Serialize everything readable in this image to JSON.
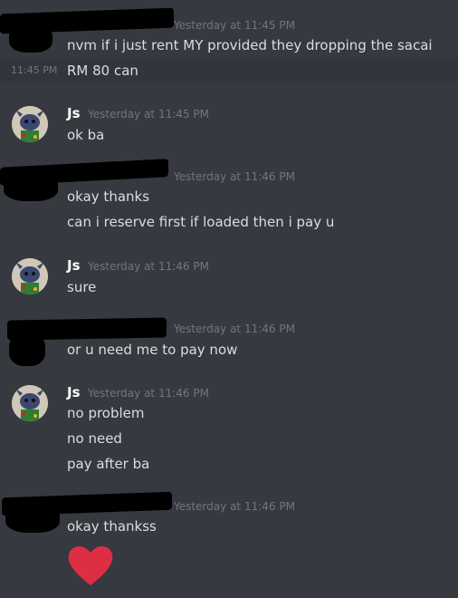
{
  "colors": {
    "background": "#36393f",
    "hover_row": "#32353b",
    "text": "#dcddde",
    "username": "#ffffff",
    "timestamp": "#72767d",
    "heart": "#dd2e44"
  },
  "messages": [
    {
      "author": "",
      "author_redacted": true,
      "timestamp": "Yesterday at 11:45 PM",
      "lines": [
        "nvm if i just rent MY provided they dropping the sacai"
      ]
    },
    {
      "hover_time": "11:45 PM",
      "lines": [
        "RM 80 can"
      ]
    },
    {
      "author": "Js",
      "timestamp": "Yesterday at 11:45 PM",
      "avatar_icon": "stitch-avatar-icon",
      "lines": [
        "ok ba"
      ]
    },
    {
      "author": "",
      "author_redacted": true,
      "timestamp": "Yesterday at 11:46 PM",
      "lines": [
        "okay thanks",
        "can i reserve first if loaded then i pay u"
      ]
    },
    {
      "author": "Js",
      "timestamp": "Yesterday at 11:46 PM",
      "avatar_icon": "stitch-avatar-icon",
      "lines": [
        "sure"
      ]
    },
    {
      "author": "",
      "author_redacted": true,
      "timestamp": "Yesterday at 11:46 PM",
      "lines": [
        "or u need me to pay now"
      ]
    },
    {
      "author": "Js",
      "timestamp": "Yesterday at 11:46 PM",
      "avatar_icon": "stitch-avatar-icon",
      "lines": [
        "no problem",
        "no need",
        "pay after ba"
      ]
    },
    {
      "author": "",
      "author_redacted": true,
      "timestamp": "Yesterday at 11:46 PM",
      "lines": [
        "okay thankss"
      ],
      "emoji": "heart-emoji-icon"
    }
  ]
}
